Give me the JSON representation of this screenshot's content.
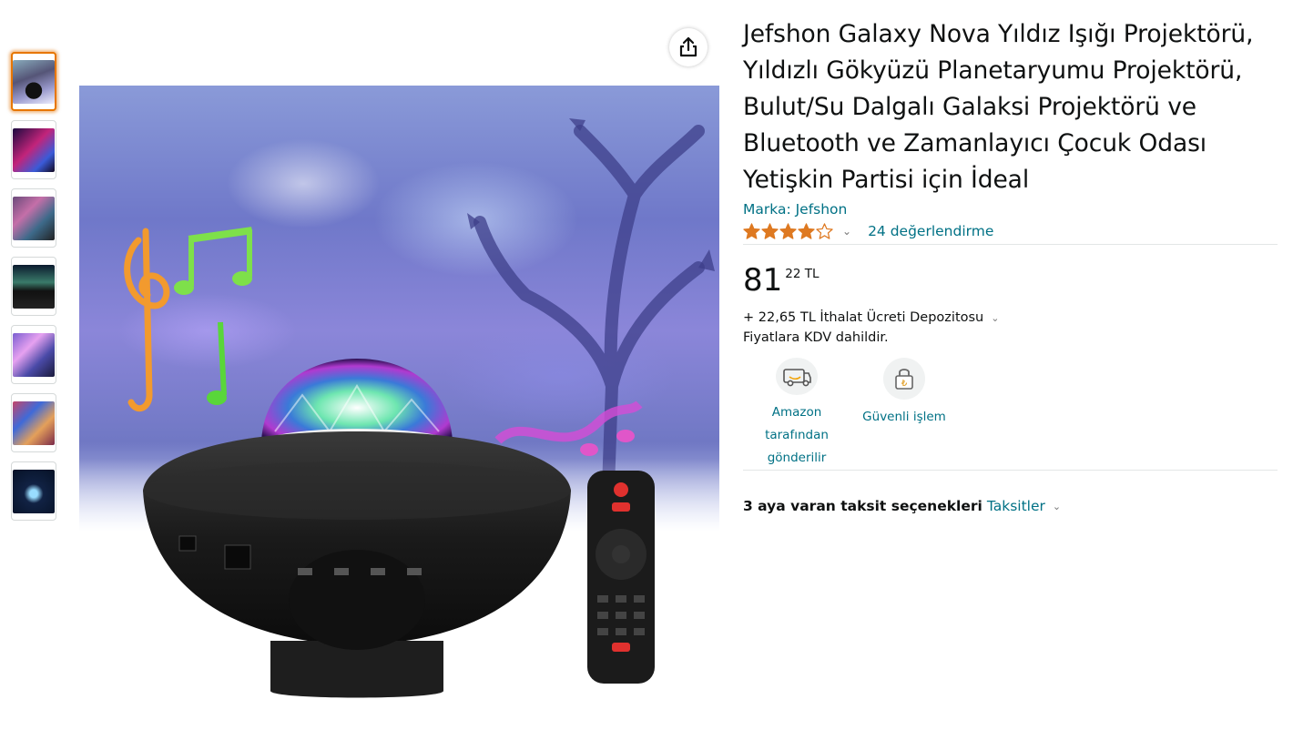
{
  "thumbnails": [
    {
      "name": "thumb-1"
    },
    {
      "name": "thumb-2"
    },
    {
      "name": "thumb-3"
    },
    {
      "name": "thumb-4"
    },
    {
      "name": "thumb-5"
    },
    {
      "name": "thumb-6"
    },
    {
      "name": "thumb-7"
    }
  ],
  "active_thumbnail_index": 1,
  "share": {
    "icon": "share-icon"
  },
  "product": {
    "title": "Jefshon Galaxy Nova Yıldız Işığı Projektörü, Yıldızlı Gökyüzü Planetaryumu Projektörü, Bulut/Su Dalgalı Galaksi Projektörü ve Bluetooth ve Zamanlayıcı Çocuk Odası Yetişkin Partisi için İdeal",
    "brand": "Marka: Jefshon",
    "rating": 4.0,
    "rating_max": 5,
    "reviews": "24 değerlendirme",
    "price_whole": "81",
    "price_fraction": "22 TL",
    "import_fee": "+ 22,65 TL İthalat Ücreti Depozitosu",
    "vat_note": "Fiyatlara KDV dahildir.",
    "badges": [
      {
        "label": "Amazon tarafından gönderilir",
        "icon": "delivery-van-icon"
      },
      {
        "label": "Güvenli işlem",
        "icon": "lock-icon"
      }
    ],
    "installment_bold": "3 aya varan taksit seçenekleri",
    "installment_link": "Taksitler"
  },
  "colors": {
    "link": "#007185",
    "star": "#de7921",
    "active_border": "#e77600"
  }
}
